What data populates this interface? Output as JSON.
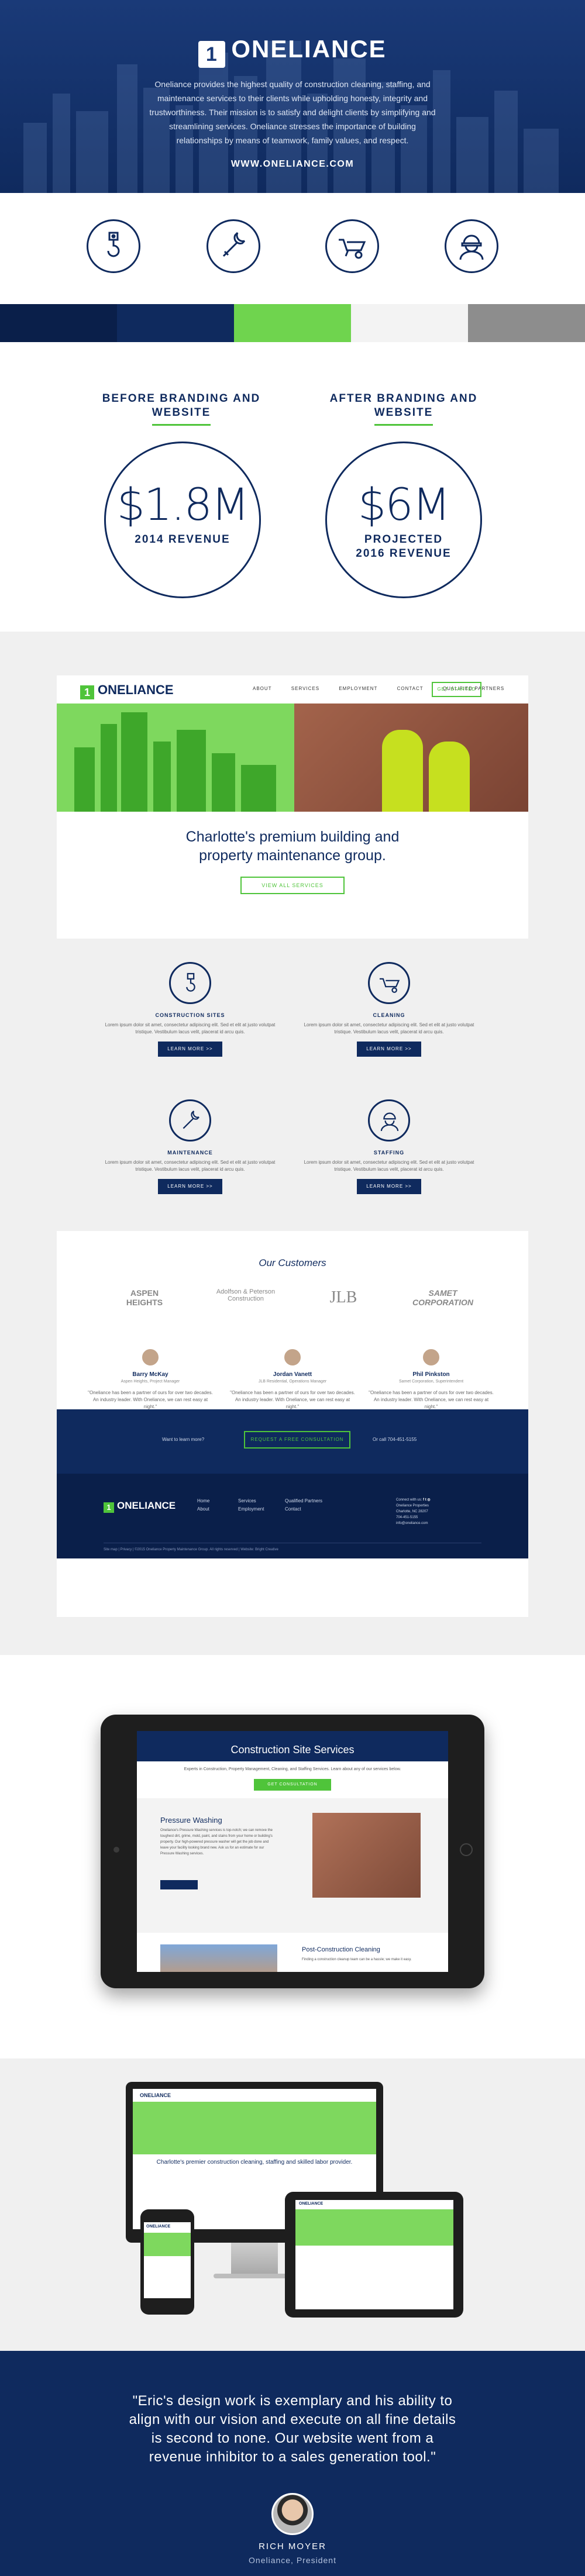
{
  "hero": {
    "logo_mark": "1",
    "logo_text": "ONELIANCE",
    "description": "Oneliance provides the highest quality of construction cleaning, staffing, and maintenance services to their clients while upholding honesty, integrity and trustworthiness. Their mission is to satisfy and delight clients by simplifying and streamlining services. Oneliance stresses the importance of building relationships by means of teamwork, family values, and respect.",
    "url": "WWW.ONELIANCE.COM"
  },
  "icons": [
    "crane-hook-icon",
    "wrench-icon",
    "wheelbarrow-icon",
    "worker-icon"
  ],
  "palette": [
    "#0a1f4a",
    "#0f2a5e",
    "#6fd44e",
    "#f3f3f3",
    "#8d8d8d"
  ],
  "before_after": {
    "before": {
      "title": "BEFORE BRANDING AND WEBSITE",
      "value": "$1.8M",
      "label": "2014 REVENUE"
    },
    "after": {
      "title": "AFTER BRANDING AND WEBSITE",
      "value": "$6M",
      "label": "PROJECTED 2016 REVENUE"
    }
  },
  "site": {
    "logo_text": "ONELIANCE",
    "nav": [
      "ABOUT",
      "SERVICES",
      "EMPLOYMENT",
      "CONTACT",
      "QUALIFIED PARTNERS"
    ],
    "nav_button": "GET STARTED",
    "tagline": "Charlotte's premium building and property maintenance group.",
    "tagline_button": "VIEW ALL SERVICES",
    "services": [
      {
        "title": "CONSTRUCTION SITES",
        "desc": "Lorem ipsum dolor sit amet, consectetur adipiscing elit. Sed et elit at justo volutpat tristique. Vestibulum lacus velit, placerat id arcu quis.",
        "button": "LEARN MORE >>"
      },
      {
        "title": "CLEANING",
        "desc": "Lorem ipsum dolor sit amet, consectetur adipiscing elit. Sed et elit at justo volutpat tristique. Vestibulum lacus velit, placerat id arcu quis.",
        "button": "LEARN MORE >>"
      },
      {
        "title": "MAINTENANCE",
        "desc": "Lorem ipsum dolor sit amet, consectetur adipiscing elit. Sed et elit at justo volutpat tristique. Vestibulum lacus velit, placerat id arcu quis.",
        "button": "LEARN MORE >>"
      },
      {
        "title": "STAFFING",
        "desc": "Lorem ipsum dolor sit amet, consectetur adipiscing elit. Sed et elit at justo volutpat tristique. Vestibulum lacus velit, placerat id arcu quis.",
        "button": "LEARN MORE >>"
      }
    ],
    "customers_title": "Our Customers",
    "customers": [
      "ASPEN HEIGHTS",
      "Adolfson & Peterson Construction",
      "JLB",
      "SAMET CORPORATION"
    ],
    "testimonials": [
      {
        "name": "Barry McKay",
        "role": "Aspen Heights, Project Manager",
        "quote": "\"Oneliance has been a partner of ours for over two decades. An industry leader. With Oneliance, we can rest easy at night.\""
      },
      {
        "name": "Jordan Vanett",
        "role": "JLB Residential, Operations Manager",
        "quote": "\"Oneliance has been a partner of ours for over two decades. An industry leader. With Oneliance, we can rest easy at night.\""
      },
      {
        "name": "Phil Pinkston",
        "role": "Samet Corporation, Superintendent",
        "quote": "\"Oneliance has been a partner of ours for over two decades. An industry leader. With Oneliance, we can rest easy at night.\""
      }
    ],
    "cta_left": "Want to learn more?",
    "cta_button": "REQUEST A FREE CONSULTATION",
    "cta_right": "Or call 704-451-5155",
    "footer_cols": [
      [
        "Home",
        "About"
      ],
      [
        "Services",
        "Employment"
      ],
      [
        "Qualified Partners",
        "Contact"
      ],
      [
        "Connect with us:",
        "Oneliance Properties",
        "Charlotte, NC 28207",
        "704-451-5155",
        "info@oneliance.com"
      ]
    ],
    "footer_bottom": "Site map | Privacy | ©2015 Oneliance Property Maintenance Group. All rights reserved | Website: Bright Creative"
  },
  "tablet": {
    "title": "Construction Site Services",
    "subtitle": "Experts in Construction, Property Management, Cleaning, and Staffing Services. Learn about any of our services below.",
    "button": "GET CONSULTATION",
    "pw_title": "Pressure Washing",
    "pw_desc": "Oneliance's Pressure Washing services is top-notch; we can remove the toughest dirt, grime, mold, paint, and stains from your home or building's property. Our high-powered pressure washer will get the job done and leave your facility looking brand new. Ask us for an estimate for our Pressure Washing services.",
    "pc_title": "Post-Construction Cleaning",
    "pc_desc": "Finding a construction cleanup team can be a hassle; we make it easy."
  },
  "devices": {
    "logo": "ONELIANCE",
    "tagline": "Charlotte's premier construction cleaning, staffing and skilled labor provider."
  },
  "quote": {
    "text": "\"Eric's design work is exemplary and his ability to align with our vision and execute on all fine details is second to none. Our website went from a revenue inhibitor to a sales generation tool.\"",
    "name": "RICH MOYER",
    "role": "Oneliance, President"
  }
}
